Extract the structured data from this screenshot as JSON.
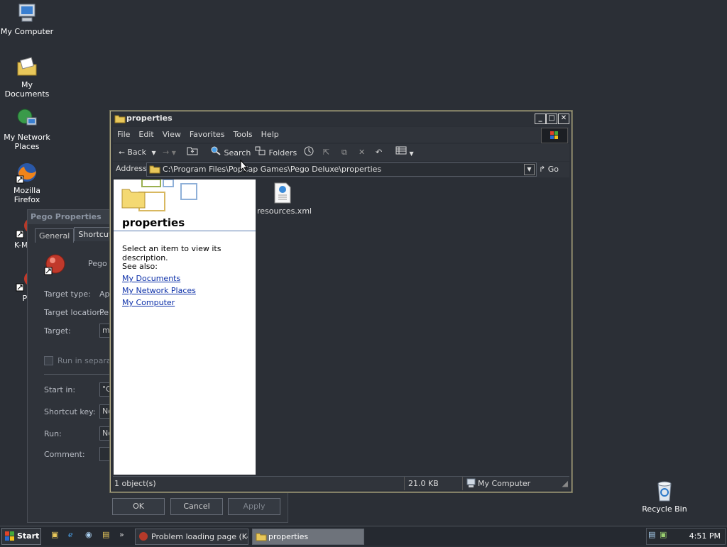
{
  "desktop": {
    "icons": [
      {
        "label": "My Computer"
      },
      {
        "label": "My Documents"
      },
      {
        "label": "My Network Places"
      },
      {
        "label": "Mozilla Firefox"
      },
      {
        "label": "K-Mele"
      },
      {
        "label": "Pe"
      },
      {
        "label": "Recycle Bin"
      }
    ]
  },
  "props_dialog": {
    "title": "Pego Properties",
    "tabs": [
      "General",
      "Shortcut"
    ],
    "app_name": "Pego",
    "target_type_label": "Target type:",
    "target_type_value": "Ap",
    "target_location_label": "Target location:",
    "target_location_value": "Pe",
    "target_label": "Target:",
    "target_value": "m",
    "run_separate_label": "Run in separate",
    "start_in_label": "Start in:",
    "start_in_value": "\"C",
    "shortcut_key_label": "Shortcut key:",
    "shortcut_key_value": "No",
    "run_label": "Run:",
    "run_value": "No",
    "comment_label": "Comment:",
    "comment_value": "",
    "ok_label": "OK",
    "cancel_label": "Cancel",
    "apply_label": "Apply"
  },
  "explorer": {
    "title": "properties",
    "menu": [
      "File",
      "Edit",
      "View",
      "Favorites",
      "Tools",
      "Help"
    ],
    "toolbar": {
      "back_label": "Back",
      "search_label": "Search",
      "folders_label": "Folders"
    },
    "address_label": "Address",
    "address_value": "C:\\Program Files\\PopCap Games\\Pego Deluxe\\properties",
    "go_label": "Go",
    "left_pane": {
      "folder_title": "properties",
      "description": "Select an item to view its description.",
      "see_also": "See also:",
      "links": [
        "My Documents",
        "My Network Places",
        "My Computer"
      ]
    },
    "files": [
      {
        "name": "resources.xml"
      }
    ],
    "status": {
      "objects": "1 object(s)",
      "size": "21.0 KB",
      "location": "My Computer"
    }
  },
  "taskbar": {
    "start_label": "Start",
    "tasks": [
      {
        "label": "Problem loading page (K-..."
      },
      {
        "label": "properties"
      }
    ],
    "time": "4:51 PM"
  }
}
